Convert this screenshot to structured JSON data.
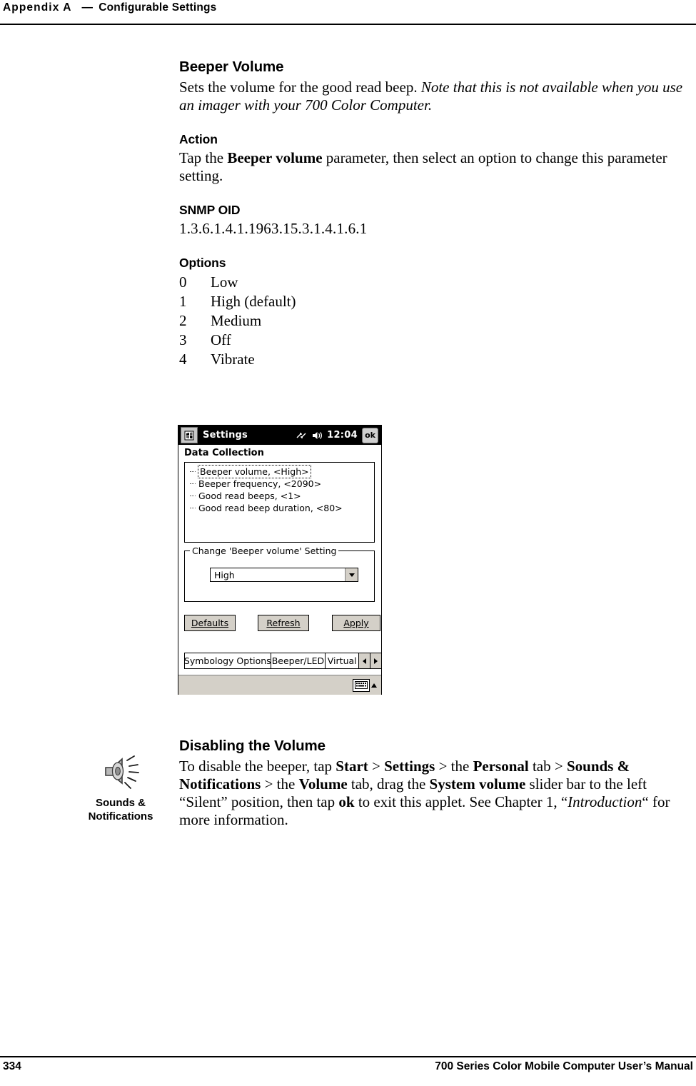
{
  "header": {
    "appendix": "Appendix A",
    "dash": "—",
    "section": "Configurable Settings"
  },
  "main": {
    "title": "Beeper Volume",
    "intro_plain": "Sets the volume for the good read beep. ",
    "intro_italic": "Note that this is not available when you use an imager with your 700 Color Computer.",
    "action_heading": "Action",
    "action_text_1": "Tap the ",
    "action_bold": "Beeper volume",
    "action_text_2": " parameter, then select an option to change this parameter setting.",
    "snmp_heading": "SNMP OID",
    "snmp_value": "1.3.6.1.4.1.1963.15.3.1.4.1.6.1",
    "options_heading": "Options",
    "options": [
      {
        "num": "0",
        "label": "Low"
      },
      {
        "num": "1",
        "label": "High (default)"
      },
      {
        "num": "2",
        "label": "Medium"
      },
      {
        "num": "3",
        "label": "Off"
      },
      {
        "num": "4",
        "label": "Vibrate"
      }
    ]
  },
  "pda": {
    "title": "Settings",
    "clock": "12:04",
    "ok_label": "ok",
    "panel_heading": "Data Collection",
    "tree_items": [
      "Beeper volume, <High>",
      "Beeper frequency, <2090>",
      "Good read beeps, <1>",
      "Good read beep duration, <80>"
    ],
    "group_legend": "Change 'Beeper volume' Setting",
    "combo_value": "High",
    "buttons": {
      "defaults": "Defaults",
      "refresh": "Refresh",
      "apply": "Apply"
    },
    "tabs": [
      "Symbology Options",
      "Beeper/LED",
      "Virtual "
    ]
  },
  "note": {
    "heading": "Disabling the Volume",
    "t1": "To disable the beeper, tap ",
    "b1": "Start",
    "t2": " > ",
    "b2": "Settings",
    "t3": " > the ",
    "b3": "Personal",
    "t4": " tab > ",
    "b4": "Sounds & Notifications",
    "t5": "  > the ",
    "b5": "Volume",
    "t6": " tab, drag the ",
    "b6": "System volume",
    "t7": " slider bar to the left “Silent” position, then tap ",
    "b7": "ok",
    "t8": " to exit this applet. See Chapter 1, “",
    "i1": "Introduction",
    "t9": "“ for more information.",
    "icon_caption_line1": "Sounds &",
    "icon_caption_line2": "Notifications"
  },
  "footer": {
    "page_number": "334",
    "manual_title": "700 Series Color Mobile Computer User’s Manual"
  }
}
